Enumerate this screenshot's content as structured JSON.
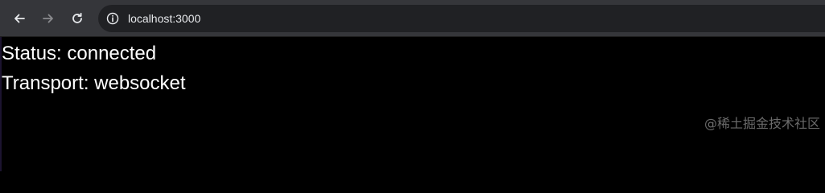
{
  "browser": {
    "url": "localhost:3000",
    "icons": {
      "back": "arrow-left-icon",
      "forward": "arrow-right-icon",
      "reload": "reload-icon",
      "site_info": "info-icon"
    }
  },
  "page": {
    "status_line": "Status: connected",
    "transport_line": "Transport: websocket"
  },
  "watermark": "@稀土掘金技术社区",
  "colors": {
    "toolbar": "#35363a",
    "omnibox": "#202124",
    "page_background": "#000000",
    "text": "#ffffff"
  }
}
